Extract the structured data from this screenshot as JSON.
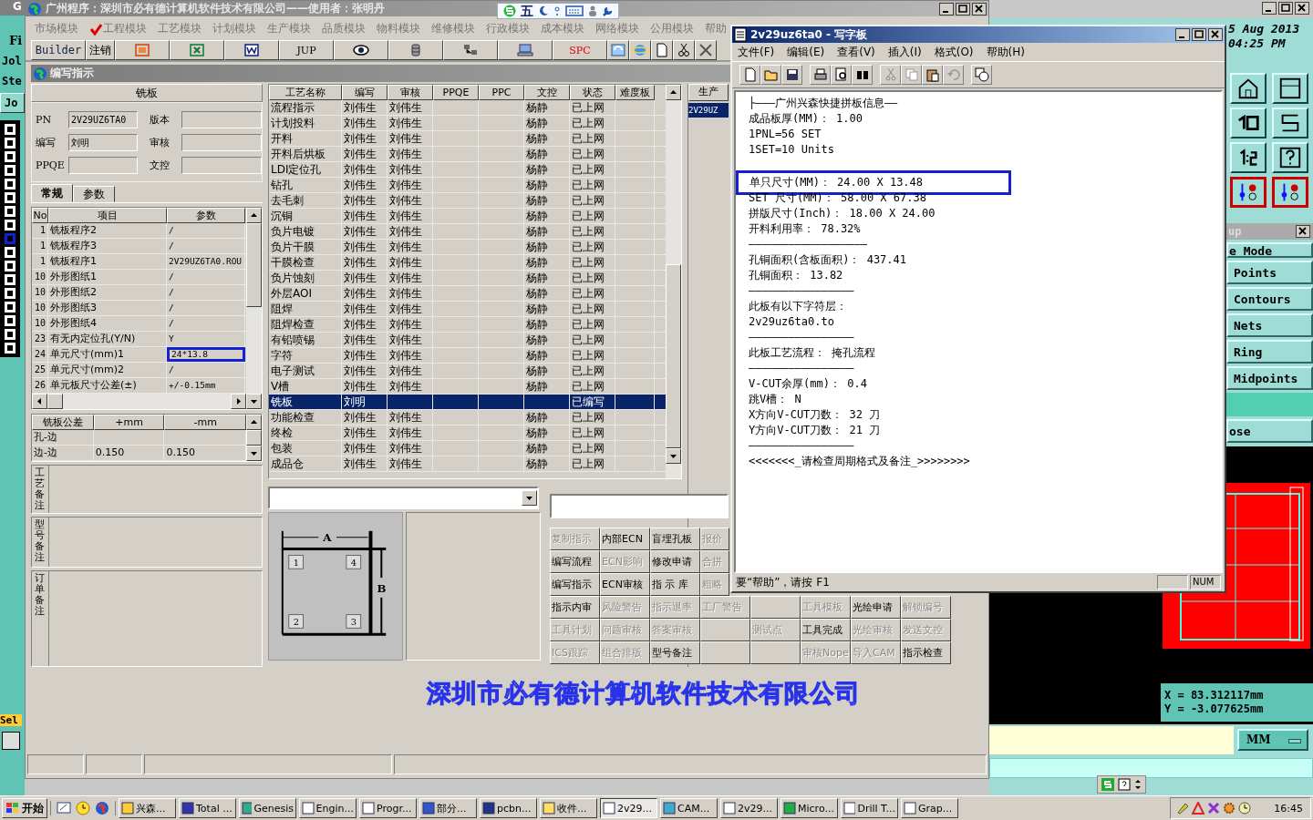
{
  "background_app": {
    "left_labels": [
      "G",
      "Fi",
      "Jol",
      "Ste"
    ],
    "left_button": "Jo",
    "select_label": "Sel",
    "date": "5 Aug 2013",
    "time": "04:25 PM",
    "popup_title": "up",
    "popup_items": [
      "e Mode",
      "Points",
      "Contours",
      "Nets",
      "Ring",
      "Midpoints"
    ],
    "close_label": "ose",
    "coords": [
      "X = 83.312117mm",
      "Y = -3.077625mm"
    ],
    "unit": "MM"
  },
  "ime": {
    "mode": "五"
  },
  "main_window": {
    "title": "广州程序：深圳市必有德计算机软件技术有限公司——使用者：张明丹",
    "menu": [
      {
        "label": "市场模块",
        "checked": false
      },
      {
        "label": "工程模块",
        "checked": true
      },
      {
        "label": "工艺模块",
        "checked": false
      },
      {
        "label": "计划模块",
        "checked": false
      },
      {
        "label": "生产模块",
        "checked": false
      },
      {
        "label": "品质模块",
        "checked": false
      },
      {
        "label": "物料模块",
        "checked": false
      },
      {
        "label": "维修模块",
        "checked": false
      },
      {
        "label": "行政模块",
        "checked": false
      },
      {
        "label": "成本模块",
        "checked": false
      },
      {
        "label": "网络模块",
        "checked": false
      },
      {
        "label": "公用模块",
        "checked": false
      },
      {
        "label": "帮助",
        "checked": false
      }
    ],
    "toolbar_text": [
      "Builder",
      "注销",
      "JUP",
      "SPC"
    ],
    "panel_title": "编写指示",
    "form": {
      "title": "铣板",
      "fields": [
        {
          "label": "PN",
          "value": "2V29UZ6TA0"
        },
        {
          "label": "版本"
        },
        {
          "label": "编写",
          "value": "刘明"
        },
        {
          "label": "审核"
        },
        {
          "label": "PPQE"
        },
        {
          "label": "文控"
        }
      ]
    },
    "tabs": [
      {
        "label": "常规",
        "selected": true
      },
      {
        "label": "参数",
        "selected": false
      }
    ],
    "params": {
      "columns": [
        "No",
        "项目",
        "参数"
      ],
      "rows": [
        {
          "no": "1",
          "item": "铣板程序2",
          "value": "/",
          "marked": false
        },
        {
          "no": "1",
          "item": "铣板程序3",
          "value": "/",
          "marked": false
        },
        {
          "no": "1",
          "item": "铣板程序1",
          "value": "2V29UZ6TA0.ROU",
          "marked": false
        },
        {
          "no": "10",
          "item": "外形图纸1",
          "value": "/",
          "marked": false
        },
        {
          "no": "10",
          "item": "外形图纸2",
          "value": "/",
          "marked": false
        },
        {
          "no": "10",
          "item": "外形图纸3",
          "value": "/",
          "marked": false
        },
        {
          "no": "10",
          "item": "外形图纸4",
          "value": "/",
          "marked": false
        },
        {
          "no": "23",
          "item": "有无内定位孔(Y/N)",
          "value": "Y",
          "marked": false
        },
        {
          "no": "24",
          "item": "单元尺寸(mm)1",
          "value": "24*13.8",
          "marked": true
        },
        {
          "no": "25",
          "item": "单元尺寸(mm)2",
          "value": "/",
          "marked": false
        },
        {
          "no": "26",
          "item": "单元板尺寸公差(±)",
          "value": "+/-0.15mm",
          "marked": false
        }
      ]
    },
    "tolerance": {
      "columns": [
        "铣板公差",
        "+mm",
        "-mm"
      ],
      "rows": [
        {
          "name": "孔-边"
        },
        {
          "name": "边-边",
          "plus": "0.150",
          "minus": "0.150"
        }
      ]
    },
    "remarks": [
      "工艺备注",
      "型号备注",
      "订单备注"
    ],
    "process": {
      "columns": [
        "工艺名称",
        "编写",
        "审核",
        "PPQE",
        "PPC",
        "文控",
        "状态",
        "难度板"
      ],
      "rows": [
        {
          "name": "流程指示",
          "writer": "刘伟生",
          "reviewer": "刘伟生",
          "control": "杨静",
          "status": "已上网",
          "selected": false
        },
        {
          "name": "计划投料",
          "writer": "刘伟生",
          "reviewer": "刘伟生",
          "control": "杨静",
          "status": "已上网",
          "selected": false
        },
        {
          "name": "开料",
          "writer": "刘伟生",
          "reviewer": "刘伟生",
          "control": "杨静",
          "status": "已上网",
          "selected": false
        },
        {
          "name": "开料后烘板",
          "writer": "刘伟生",
          "reviewer": "刘伟生",
          "control": "杨静",
          "status": "已上网",
          "selected": false
        },
        {
          "name": "LDI定位孔",
          "writer": "刘伟生",
          "reviewer": "刘伟生",
          "control": "杨静",
          "status": "已上网",
          "selected": false
        },
        {
          "name": "钻孔",
          "writer": "刘伟生",
          "reviewer": "刘伟生",
          "control": "杨静",
          "status": "已上网",
          "selected": false
        },
        {
          "name": "去毛刺",
          "writer": "刘伟生",
          "reviewer": "刘伟生",
          "control": "杨静",
          "status": "已上网",
          "selected": false
        },
        {
          "name": "沉铜",
          "writer": "刘伟生",
          "reviewer": "刘伟生",
          "control": "杨静",
          "status": "已上网",
          "selected": false
        },
        {
          "name": "负片电镀",
          "writer": "刘伟生",
          "reviewer": "刘伟生",
          "control": "杨静",
          "status": "已上网",
          "selected": false
        },
        {
          "name": "负片干膜",
          "writer": "刘伟生",
          "reviewer": "刘伟生",
          "control": "杨静",
          "status": "已上网",
          "selected": false
        },
        {
          "name": "干膜检查",
          "writer": "刘伟生",
          "reviewer": "刘伟生",
          "control": "杨静",
          "status": "已上网",
          "selected": false
        },
        {
          "name": "负片蚀刻",
          "writer": "刘伟生",
          "reviewer": "刘伟生",
          "control": "杨静",
          "status": "已上网",
          "selected": false
        },
        {
          "name": "外层AOI",
          "writer": "刘伟生",
          "reviewer": "刘伟生",
          "control": "杨静",
          "status": "已上网",
          "selected": false
        },
        {
          "name": "阻焊",
          "writer": "刘伟生",
          "reviewer": "刘伟生",
          "control": "杨静",
          "status": "已上网",
          "selected": false
        },
        {
          "name": "阻焊检查",
          "writer": "刘伟生",
          "reviewer": "刘伟生",
          "control": "杨静",
          "status": "已上网",
          "selected": false
        },
        {
          "name": "有铅喷锡",
          "writer": "刘伟生",
          "reviewer": "刘伟生",
          "control": "杨静",
          "status": "已上网",
          "selected": false
        },
        {
          "name": "字符",
          "writer": "刘伟生",
          "reviewer": "刘伟生",
          "control": "杨静",
          "status": "已上网",
          "selected": false
        },
        {
          "name": "电子测试",
          "writer": "刘伟生",
          "reviewer": "刘伟生",
          "control": "杨静",
          "status": "已上网",
          "selected": false
        },
        {
          "name": "V槽",
          "writer": "刘伟生",
          "reviewer": "刘伟生",
          "control": "杨静",
          "status": "已上网",
          "selected": false
        },
        {
          "name": "铣板",
          "writer": "刘明",
          "status": "已编写",
          "selected": true
        },
        {
          "name": "功能检查",
          "writer": "刘伟生",
          "reviewer": "刘伟生",
          "control": "杨静",
          "status": "已上网",
          "selected": false
        },
        {
          "name": "终检",
          "writer": "刘伟生",
          "reviewer": "刘伟生",
          "control": "杨静",
          "status": "已上网",
          "selected": false
        },
        {
          "name": "包装",
          "writer": "刘伟生",
          "reviewer": "刘伟生",
          "control": "杨静",
          "status": "已上网",
          "selected": false
        },
        {
          "name": "成品仓",
          "writer": "刘伟生",
          "reviewer": "刘伟生",
          "control": "杨静",
          "status": "已上网",
          "selected": false
        }
      ]
    },
    "side_list": {
      "header": "生产",
      "item": "2V29UZ"
    },
    "diagram": {
      "width_label": "A",
      "height_label": "B",
      "corners": [
        "1",
        "4",
        "2",
        "3"
      ]
    },
    "actions": [
      [
        {
          "kind": "button",
          "label": "复制指示",
          "disabled": true
        },
        {
          "kind": "button",
          "label": "内部ECN",
          "disabled": false
        },
        {
          "kind": "button",
          "label": "盲埋孔板",
          "disabled": false
        },
        {
          "kind": "button",
          "label": "报价",
          "disabled": true
        }
      ],
      [
        {
          "kind": "button",
          "label": "编写流程",
          "disabled": false
        },
        {
          "kind": "button",
          "label": "ECN影响",
          "disabled": true
        },
        {
          "kind": "button",
          "label": "修改申请",
          "disabled": false
        },
        {
          "kind": "button",
          "label": "合拼",
          "disabled": true
        }
      ],
      [
        {
          "kind": "button",
          "label": "编写指示",
          "disabled": false
        },
        {
          "kind": "button",
          "label": "ECN审核",
          "disabled": false
        },
        {
          "kind": "button",
          "label": "指 示 库",
          "disabled": false
        },
        {
          "kind": "button",
          "label": "粗略",
          "disabled": true
        }
      ],
      [
        {
          "kind": "button",
          "label": "指示内审",
          "disabled": false
        },
        {
          "kind": "button",
          "label": "风险警告",
          "disabled": true
        },
        {
          "kind": "button",
          "label": "指示退率",
          "disabled": true
        },
        {
          "kind": "button",
          "label": "工厂警告",
          "disabled": true
        },
        {
          "kind": "blank"
        },
        {
          "kind": "button",
          "label": "工具模板",
          "disabled": true
        },
        {
          "kind": "button",
          "label": "光绘申请",
          "disabled": false
        },
        {
          "kind": "button",
          "label": "解锁编号",
          "disabled": true
        }
      ],
      [
        {
          "kind": "button",
          "label": "工具计划",
          "disabled": true
        },
        {
          "kind": "button",
          "label": "问题审核",
          "disabled": true
        },
        {
          "kind": "button",
          "label": "答案审核",
          "disabled": true
        },
        {
          "kind": "blank"
        },
        {
          "kind": "button",
          "label": "测试点",
          "disabled": true
        },
        {
          "kind": "button",
          "label": "工具完成",
          "disabled": false
        },
        {
          "kind": "button",
          "label": "光绘审核",
          "disabled": true
        },
        {
          "kind": "button",
          "label": "发送文控",
          "disabled": true
        }
      ],
      [
        {
          "kind": "button",
          "label": "ICS跟踪",
          "disabled": true
        },
        {
          "kind": "button",
          "label": "组合排版",
          "disabled": true
        },
        {
          "kind": "button",
          "label": "型号备注",
          "disabled": false
        },
        {
          "kind": "blank"
        },
        {
          "kind": "blank"
        },
        {
          "kind": "button",
          "label": "审核Nope",
          "disabled": true
        },
        {
          "kind": "button",
          "label": "导入CAM",
          "disabled": true
        },
        {
          "kind": "button",
          "label": "指示检查",
          "disabled": false
        }
      ]
    ],
    "banner": "深圳市必有德计算机软件技术有限公司"
  },
  "wordpad": {
    "title": "2v29uz6ta0 - 写字板",
    "menu": [
      "文件(F)",
      "编辑(E)",
      "查看(V)",
      "插入(I)",
      "格式(O)",
      "帮助(H)"
    ],
    "lines": [
      {
        "kind": "text",
        "text": "├———广州兴森快捷拼板信息——"
      },
      {
        "kind": "text",
        "text": "成品板厚(MM)： 1.00"
      },
      {
        "kind": "text",
        "text": "1PNL=56 SET"
      },
      {
        "kind": "text",
        "text": "1SET=10 Units"
      },
      {
        "kind": "blank"
      },
      {
        "kind": "text",
        "text": "单只尺寸(MM)： 24.00 X 13.48",
        "marked": true
      },
      {
        "kind": "text",
        "text": "SET 尺寸(MM)： 58.00 X 67.38"
      },
      {
        "kind": "text",
        "text": "拼版尺寸(Inch)： 18.00 X 24.00"
      },
      {
        "kind": "text",
        "text": "开料利用率： 78.32%"
      },
      {
        "kind": "text",
        "text": "——————————————————"
      },
      {
        "kind": "text",
        "text": "孔铜面积(含板面积)： 437.41"
      },
      {
        "kind": "text",
        "text": "孔铜面积： 13.82"
      },
      {
        "kind": "text",
        "text": "————————————————"
      },
      {
        "kind": "text",
        "text": "此板有以下字符层："
      },
      {
        "kind": "text",
        "text": "2v29uz6ta0.to"
      },
      {
        "kind": "text",
        "text": "————————————————"
      },
      {
        "kind": "text",
        "text": "此板工艺流程： 掩孔流程"
      },
      {
        "kind": "text",
        "text": "————————————————"
      },
      {
        "kind": "text",
        "text": "V-CUT余厚(mm)： 0.4"
      },
      {
        "kind": "text",
        "text": "跳V槽： N"
      },
      {
        "kind": "text",
        "text": "X方向V-CUT刀数： 32 刀"
      },
      {
        "kind": "text",
        "text": "Y方向V-CUT刀数： 21 刀"
      },
      {
        "kind": "text",
        "text": "————————————————"
      },
      {
        "kind": "text",
        "text": "<<<<<<<_请检查周期格式及备注_>>>>>>>>"
      }
    ],
    "status": "要“帮助”，请按 F1",
    "num": "NUM"
  },
  "taskbar": {
    "start": "开始",
    "tasks": [
      {
        "label": "兴森...",
        "selected": false
      },
      {
        "label": "Total ...",
        "selected": false
      },
      {
        "label": "Genesis",
        "selected": false
      },
      {
        "label": "Engin...",
        "selected": false
      },
      {
        "label": "Progr...",
        "selected": false
      },
      {
        "label": "部分...",
        "selected": false
      },
      {
        "label": "pcbn...",
        "selected": false
      },
      {
        "label": "收件...",
        "selected": false
      },
      {
        "label": "2v29...",
        "selected": true
      },
      {
        "label": "CAM...",
        "selected": false
      },
      {
        "label": "2v29...",
        "selected": false
      },
      {
        "label": "Micro...",
        "selected": false
      },
      {
        "label": "Drill T...",
        "selected": false
      },
      {
        "label": "Grap...",
        "selected": false
      }
    ],
    "clock": "16:45"
  }
}
